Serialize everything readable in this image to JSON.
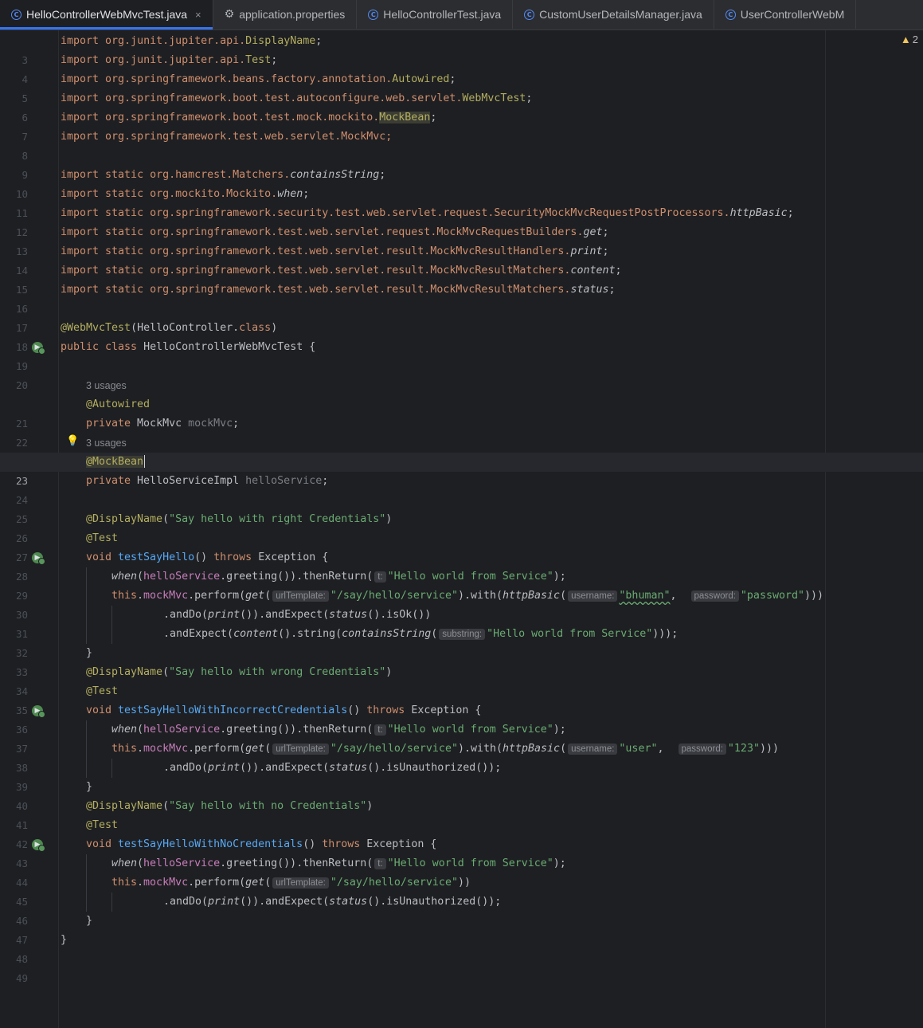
{
  "tabs": [
    {
      "label": "HelloControllerWebMvcTest.java",
      "icon": "class-icon",
      "active": true,
      "closable": true
    },
    {
      "label": "application.properties",
      "icon": "gear-icon",
      "active": false
    },
    {
      "label": "HelloControllerTest.java",
      "icon": "class-icon",
      "active": false
    },
    {
      "label": "CustomUserDetailsManager.java",
      "icon": "class-icon",
      "active": false
    },
    {
      "label": "UserControllerWebM",
      "icon": "class-icon",
      "active": false
    }
  ],
  "tab_class_glyph": "C",
  "tab_close_glyph": "×",
  "warnings": {
    "count": "2",
    "icon": "warning-icon"
  },
  "hints": {
    "usages_3": "3 usages"
  },
  "param_hints": {
    "t": "t:",
    "urlTemplate": "urlTemplate:",
    "username": "username:",
    "password": "password:",
    "substring": "substring:"
  },
  "lines": {
    "3": {
      "n": "3",
      "a": "import org.junit.jupiter.api.",
      "b": "DisplayName",
      "c": ";"
    },
    "4": {
      "n": "4",
      "a": "import org.junit.jupiter.api.",
      "b": "Test",
      "c": ";"
    },
    "5": {
      "n": "5",
      "a": "import org.springframework.beans.factory.annotation.",
      "b": "Autowired",
      "c": ";"
    },
    "6": {
      "n": "6",
      "a": "import org.springframework.boot.test.autoconfigure.web.servlet.",
      "b": "WebMvcTest",
      "c": ";"
    },
    "7": {
      "n": "7",
      "a": "import org.springframework.boot.test.mock.mockito.",
      "b": "MockBean",
      "c": ";"
    },
    "8": {
      "n": "8",
      "a": "import org.springframework.test.web.servlet.MockMvc;"
    },
    "9": {
      "n": "9"
    },
    "10": {
      "n": "10",
      "a": "import static org.hamcrest.Matchers.",
      "b": "containsString",
      "c": ";"
    },
    "11": {
      "n": "11",
      "a": "import static org.mockito.Mockito.",
      "b": "when",
      "c": ";"
    },
    "12": {
      "n": "12",
      "a": "import static org.springframework.security.test.web.servlet.request.SecurityMockMvcRequestPostProcessors.",
      "b": "httpBasic",
      "c": ";"
    },
    "13": {
      "n": "13",
      "a": "import static org.springframework.test.web.servlet.request.MockMvcRequestBuilders.",
      "b": "get",
      "c": ";"
    },
    "14": {
      "n": "14",
      "a": "import static org.springframework.test.web.servlet.result.MockMvcResultHandlers.",
      "b": "print",
      "c": ";"
    },
    "15": {
      "n": "15",
      "a": "import static org.springframework.test.web.servlet.result.MockMvcResultMatchers.",
      "b": "content",
      "c": ";"
    },
    "16": {
      "n": "16",
      "a": "import static org.springframework.test.web.servlet.result.MockMvcResultMatchers.",
      "b": "status",
      "c": ";"
    },
    "17": {
      "n": "17"
    },
    "18": {
      "n": "18",
      "a": "@WebMvcTest",
      "b": "(HelloController.",
      "c": "class",
      "d": ")"
    },
    "19": {
      "n": "19",
      "a": "public class ",
      "b": "HelloControllerWebMvcTest {"
    },
    "20": {
      "n": "20"
    },
    "21": {
      "n": "21",
      "a": "@Autowired"
    },
    "22": {
      "n": "22",
      "a": "private ",
      "b": "MockMvc ",
      "c": "mockMvc",
      "d": ";"
    },
    "23": {
      "n": "23",
      "a": "@MockBean"
    },
    "24": {
      "n": "24",
      "a": "private ",
      "b": "HelloServiceImpl ",
      "c": "helloService",
      "d": ";"
    },
    "25": {
      "n": "25"
    },
    "26": {
      "n": "26",
      "a": "@DisplayName",
      "b": "(",
      "c": "\"Say hello with right Credentials\"",
      "d": ")"
    },
    "27": {
      "n": "27",
      "a": "@Test"
    },
    "28": {
      "n": "28",
      "a": "void ",
      "b": "testSayHello",
      "c": "() ",
      "d": "throws ",
      "e": "Exception {"
    },
    "29": {
      "n": "29",
      "a": "when",
      "b": "(",
      "c": "helloService",
      "d": ".greeting()).thenReturn(",
      "s": "\"Hello world from Service\"",
      "e": ");"
    },
    "30": {
      "n": "30",
      "a": "this",
      "b": ".",
      "c": "mockMvc",
      "d": ".perform(",
      "f": "get",
      "g": "(",
      "s1": "\"/say/hello/service\"",
      "h": ").with(",
      "i": "httpBasic",
      "j": "(",
      "s2": "\"bhuman\"",
      "k": ",  ",
      "s3": "\"password\"",
      "l": ")))"
    },
    "31": {
      "n": "31",
      "a": ".andDo(",
      "b": "print",
      "c": "()).andExpect(",
      "d": "status",
      "e": "().isOk())"
    },
    "32": {
      "n": "32",
      "a": ".andExpect(",
      "b": "content",
      "c": "().string(",
      "d": "containsString",
      "e": "(",
      "s": "\"Hello world from Service\"",
      "f": ")));"
    },
    "33": {
      "n": "33",
      "a": "}"
    },
    "34": {
      "n": "34",
      "a": "@DisplayName",
      "b": "(",
      "c": "\"Say hello with wrong Credentials\"",
      "d": ")"
    },
    "35": {
      "n": "35",
      "a": "@Test"
    },
    "36": {
      "n": "36",
      "a": "void ",
      "b": "testSayHelloWithIncorrectCredentials",
      "c": "() ",
      "d": "throws ",
      "e": "Exception {"
    },
    "37": {
      "n": "37",
      "a": "when",
      "b": "(",
      "c": "helloService",
      "d": ".greeting()).thenReturn(",
      "s": "\"Hello world from Service\"",
      "e": ");"
    },
    "38": {
      "n": "38",
      "a": "this",
      "b": ".",
      "c": "mockMvc",
      "d": ".perform(",
      "f": "get",
      "g": "(",
      "s1": "\"/say/hello/service\"",
      "h": ").with(",
      "i": "httpBasic",
      "j": "(",
      "s2": "\"user\"",
      "k": ",  ",
      "s3": "\"123\"",
      "l": ")))"
    },
    "39": {
      "n": "39",
      "a": ".andDo(",
      "b": "print",
      "c": "()).andExpect(",
      "d": "status",
      "e": "().isUnauthorized());"
    },
    "40": {
      "n": "40",
      "a": "}"
    },
    "41": {
      "n": "41",
      "a": "@DisplayName",
      "b": "(",
      "c": "\"Say hello with no Credentials\"",
      "d": ")"
    },
    "42": {
      "n": "42",
      "a": "@Test"
    },
    "43": {
      "n": "43",
      "a": "void ",
      "b": "testSayHelloWithNoCredentials",
      "c": "() ",
      "d": "throws ",
      "e": "Exception {"
    },
    "44": {
      "n": "44",
      "a": "when",
      "b": "(",
      "c": "helloService",
      "d": ".greeting()).thenReturn(",
      "s": "\"Hello world from Service\"",
      "e": ");"
    },
    "45": {
      "n": "45",
      "a": "this",
      "b": ".",
      "c": "mockMvc",
      "d": ".perform(",
      "f": "get",
      "g": "(",
      "s1": "\"/say/hello/service\"",
      "h": "))"
    },
    "46": {
      "n": "46",
      "a": ".andDo(",
      "b": "print",
      "c": "()).andExpect(",
      "d": "status",
      "e": "().isUnauthorized());"
    },
    "47": {
      "n": "47",
      "a": "}"
    },
    "48": {
      "n": "48",
      "a": "}"
    },
    "49": {
      "n": "49"
    }
  },
  "colors": {
    "keyword": "#cf8e6d",
    "annotation": "#b3ae60",
    "string": "#6aab73",
    "field": "#c77dbb",
    "method": "#56a8f5",
    "background": "#1e1f22",
    "accent": "#3574f0"
  }
}
